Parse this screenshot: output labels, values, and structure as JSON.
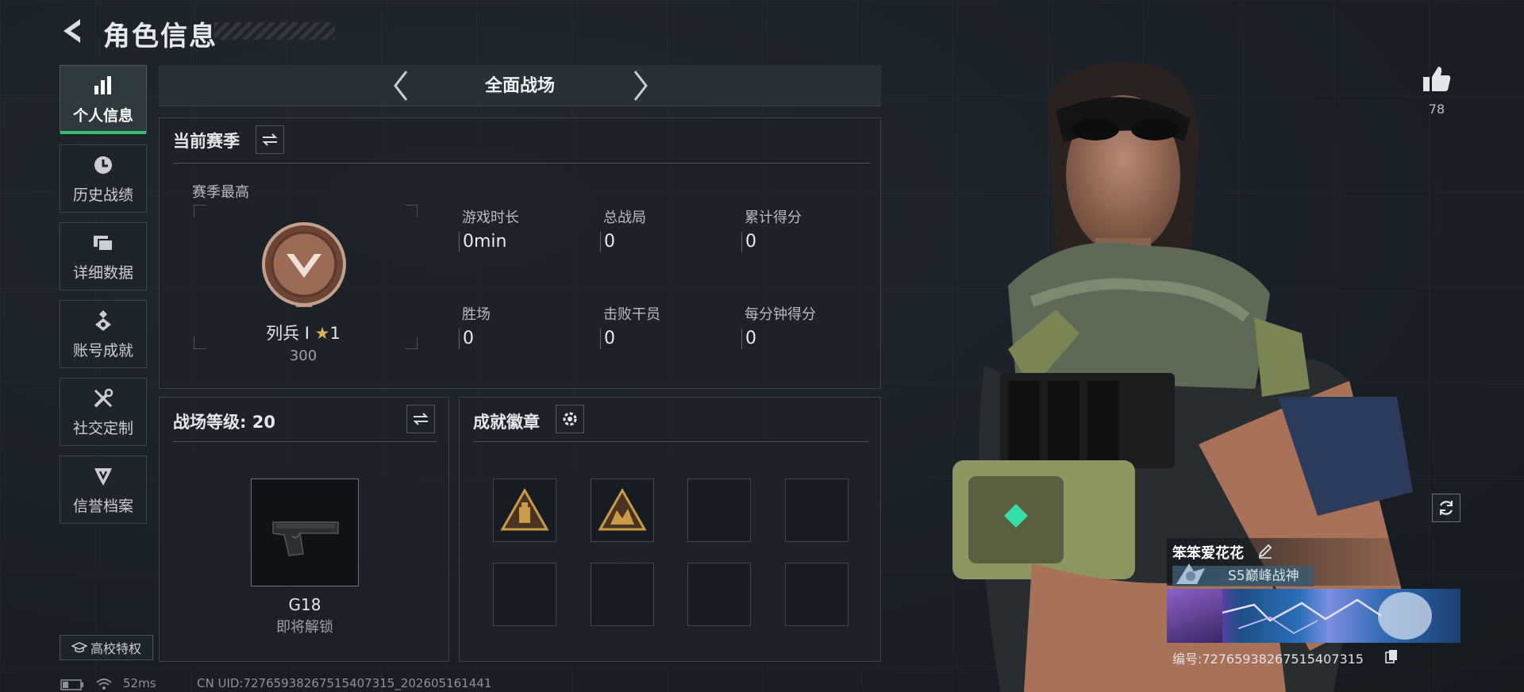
{
  "header": {
    "title": "角色信息"
  },
  "sidebar": {
    "items": [
      {
        "label": "个人信息",
        "icon": "bar-chart-icon",
        "active": true
      },
      {
        "label": "历史战绩",
        "icon": "history-clock-icon"
      },
      {
        "label": "详细数据",
        "icon": "data-cards-icon"
      },
      {
        "label": "账号成就",
        "icon": "achievement-medal-icon"
      },
      {
        "label": "社交定制",
        "icon": "tools-wrench-icon"
      },
      {
        "label": "信誉档案",
        "icon": "reputation-shield-icon"
      }
    ],
    "campus_label": "高校特权"
  },
  "mode": {
    "title": "全面战场"
  },
  "season": {
    "title": "当前赛季",
    "best_label": "赛季最高",
    "rank_name": "列兵 I",
    "rank_stars": "1",
    "rank_score": "300",
    "stats": [
      {
        "label": "游戏时长",
        "value": "0min"
      },
      {
        "label": "总战局",
        "value": "0"
      },
      {
        "label": "累计得分",
        "value": "0"
      },
      {
        "label": "胜场",
        "value": "0"
      },
      {
        "label": "击败干员",
        "value": "0"
      },
      {
        "label": "每分钟得分",
        "value": "0"
      }
    ]
  },
  "level": {
    "title": "战场等级: 20",
    "weapon_name": "G18",
    "weapon_status": "即将解锁"
  },
  "badges": {
    "title": "成就徽章",
    "slots": 8,
    "filled": 2
  },
  "likes": {
    "count": "78"
  },
  "profile": {
    "name": "笨笨爱花花",
    "title": "S5巅峰战神",
    "uid": "编号:72765938267515407315"
  },
  "status_bar": {
    "ping": "52ms",
    "cn_uid": "CN UID:72765938267515407315_202605161441"
  },
  "colors": {
    "accent": "#35c06e",
    "rank_bronze": "#8a5a45",
    "badge_gold": "#c99a47"
  }
}
